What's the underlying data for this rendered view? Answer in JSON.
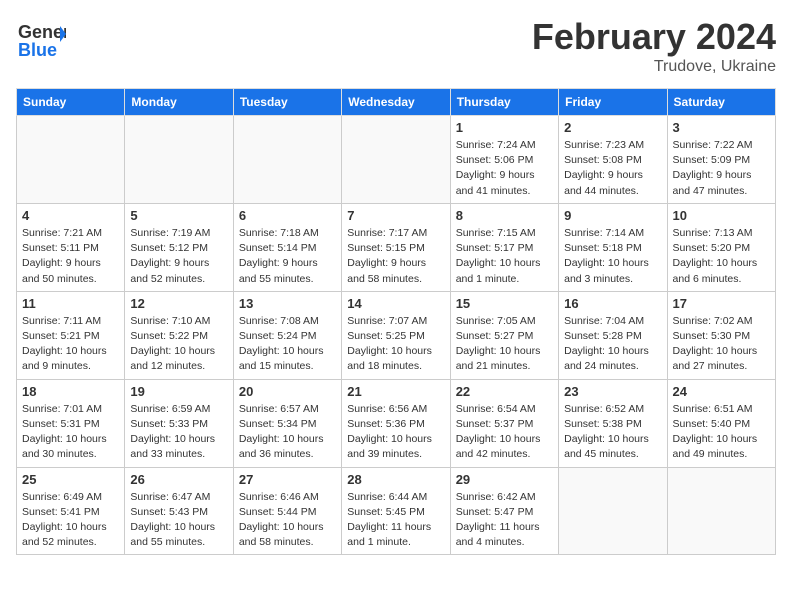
{
  "header": {
    "logo_general": "General",
    "logo_blue": "Blue",
    "month_title": "February 2024",
    "location": "Trudove, Ukraine"
  },
  "weekdays": [
    "Sunday",
    "Monday",
    "Tuesday",
    "Wednesday",
    "Thursday",
    "Friday",
    "Saturday"
  ],
  "weeks": [
    [
      {
        "day": "",
        "info": ""
      },
      {
        "day": "",
        "info": ""
      },
      {
        "day": "",
        "info": ""
      },
      {
        "day": "",
        "info": ""
      },
      {
        "day": "1",
        "info": "Sunrise: 7:24 AM\nSunset: 5:06 PM\nDaylight: 9 hours\nand 41 minutes."
      },
      {
        "day": "2",
        "info": "Sunrise: 7:23 AM\nSunset: 5:08 PM\nDaylight: 9 hours\nand 44 minutes."
      },
      {
        "day": "3",
        "info": "Sunrise: 7:22 AM\nSunset: 5:09 PM\nDaylight: 9 hours\nand 47 minutes."
      }
    ],
    [
      {
        "day": "4",
        "info": "Sunrise: 7:21 AM\nSunset: 5:11 PM\nDaylight: 9 hours\nand 50 minutes."
      },
      {
        "day": "5",
        "info": "Sunrise: 7:19 AM\nSunset: 5:12 PM\nDaylight: 9 hours\nand 52 minutes."
      },
      {
        "day": "6",
        "info": "Sunrise: 7:18 AM\nSunset: 5:14 PM\nDaylight: 9 hours\nand 55 minutes."
      },
      {
        "day": "7",
        "info": "Sunrise: 7:17 AM\nSunset: 5:15 PM\nDaylight: 9 hours\nand 58 minutes."
      },
      {
        "day": "8",
        "info": "Sunrise: 7:15 AM\nSunset: 5:17 PM\nDaylight: 10 hours\nand 1 minute."
      },
      {
        "day": "9",
        "info": "Sunrise: 7:14 AM\nSunset: 5:18 PM\nDaylight: 10 hours\nand 3 minutes."
      },
      {
        "day": "10",
        "info": "Sunrise: 7:13 AM\nSunset: 5:20 PM\nDaylight: 10 hours\nand 6 minutes."
      }
    ],
    [
      {
        "day": "11",
        "info": "Sunrise: 7:11 AM\nSunset: 5:21 PM\nDaylight: 10 hours\nand 9 minutes."
      },
      {
        "day": "12",
        "info": "Sunrise: 7:10 AM\nSunset: 5:22 PM\nDaylight: 10 hours\nand 12 minutes."
      },
      {
        "day": "13",
        "info": "Sunrise: 7:08 AM\nSunset: 5:24 PM\nDaylight: 10 hours\nand 15 minutes."
      },
      {
        "day": "14",
        "info": "Sunrise: 7:07 AM\nSunset: 5:25 PM\nDaylight: 10 hours\nand 18 minutes."
      },
      {
        "day": "15",
        "info": "Sunrise: 7:05 AM\nSunset: 5:27 PM\nDaylight: 10 hours\nand 21 minutes."
      },
      {
        "day": "16",
        "info": "Sunrise: 7:04 AM\nSunset: 5:28 PM\nDaylight: 10 hours\nand 24 minutes."
      },
      {
        "day": "17",
        "info": "Sunrise: 7:02 AM\nSunset: 5:30 PM\nDaylight: 10 hours\nand 27 minutes."
      }
    ],
    [
      {
        "day": "18",
        "info": "Sunrise: 7:01 AM\nSunset: 5:31 PM\nDaylight: 10 hours\nand 30 minutes."
      },
      {
        "day": "19",
        "info": "Sunrise: 6:59 AM\nSunset: 5:33 PM\nDaylight: 10 hours\nand 33 minutes."
      },
      {
        "day": "20",
        "info": "Sunrise: 6:57 AM\nSunset: 5:34 PM\nDaylight: 10 hours\nand 36 minutes."
      },
      {
        "day": "21",
        "info": "Sunrise: 6:56 AM\nSunset: 5:36 PM\nDaylight: 10 hours\nand 39 minutes."
      },
      {
        "day": "22",
        "info": "Sunrise: 6:54 AM\nSunset: 5:37 PM\nDaylight: 10 hours\nand 42 minutes."
      },
      {
        "day": "23",
        "info": "Sunrise: 6:52 AM\nSunset: 5:38 PM\nDaylight: 10 hours\nand 45 minutes."
      },
      {
        "day": "24",
        "info": "Sunrise: 6:51 AM\nSunset: 5:40 PM\nDaylight: 10 hours\nand 49 minutes."
      }
    ],
    [
      {
        "day": "25",
        "info": "Sunrise: 6:49 AM\nSunset: 5:41 PM\nDaylight: 10 hours\nand 52 minutes."
      },
      {
        "day": "26",
        "info": "Sunrise: 6:47 AM\nSunset: 5:43 PM\nDaylight: 10 hours\nand 55 minutes."
      },
      {
        "day": "27",
        "info": "Sunrise: 6:46 AM\nSunset: 5:44 PM\nDaylight: 10 hours\nand 58 minutes."
      },
      {
        "day": "28",
        "info": "Sunrise: 6:44 AM\nSunset: 5:45 PM\nDaylight: 11 hours\nand 1 minute."
      },
      {
        "day": "29",
        "info": "Sunrise: 6:42 AM\nSunset: 5:47 PM\nDaylight: 11 hours\nand 4 minutes."
      },
      {
        "day": "",
        "info": ""
      },
      {
        "day": "",
        "info": ""
      }
    ]
  ]
}
